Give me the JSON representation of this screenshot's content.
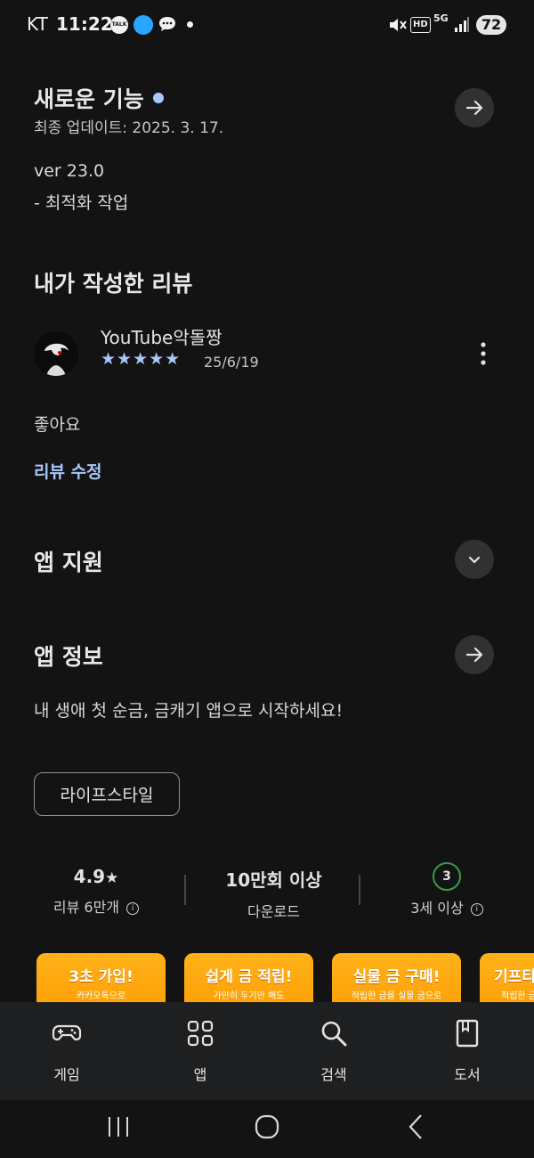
{
  "status_bar": {
    "carrier": "KT",
    "time": "11:22",
    "talk_badge": "TALK",
    "network": "5G",
    "hd": "HD",
    "battery": "72"
  },
  "whats_new": {
    "title": "새로운 기능",
    "updated": "최종 업데이트: 2025. 3. 17.",
    "version": "ver 23.0",
    "note": "- 최적화 작업"
  },
  "my_review": {
    "title": "내가 작성한 리뷰",
    "user": "YouTube악돌짱",
    "stars": 5,
    "star_glyphs": "★★★★★",
    "date": "25/6/19",
    "text": "좋아요",
    "edit_label": "리뷰 수정"
  },
  "app_support": {
    "title": "앱 지원"
  },
  "app_info": {
    "title": "앱 정보",
    "description": "내 생애 첫 순금, 금캐기 앱으로 시작하세요!",
    "category_chip": "라이프스타일"
  },
  "stats": {
    "rating": "4.9",
    "rating_star": "★",
    "reviews": "리뷰 6만개",
    "downloads": "10만회 이상",
    "downloads_label": "다운로드",
    "age_badge": "3",
    "age_label": "3세 이상"
  },
  "screenshots": [
    {
      "title": "3초 가입!",
      "sub": "카카오톡으로"
    },
    {
      "title": "쉽게 금 적립!",
      "sub": "가만히 두기만 해도"
    },
    {
      "title": "실물 금 구매!",
      "sub": "적립한 금을 실물 금으로"
    },
    {
      "title": "기프티",
      "sub": "적립한 금"
    }
  ],
  "bottom_nav": {
    "games": "게임",
    "apps": "앱",
    "search": "검색",
    "books": "도서"
  },
  "colors": {
    "background": "#131314",
    "accent_link": "#a8c7fa",
    "star": "#a8c7fa",
    "age_badge": "#3c9a4a",
    "banner": "#ffa000"
  }
}
